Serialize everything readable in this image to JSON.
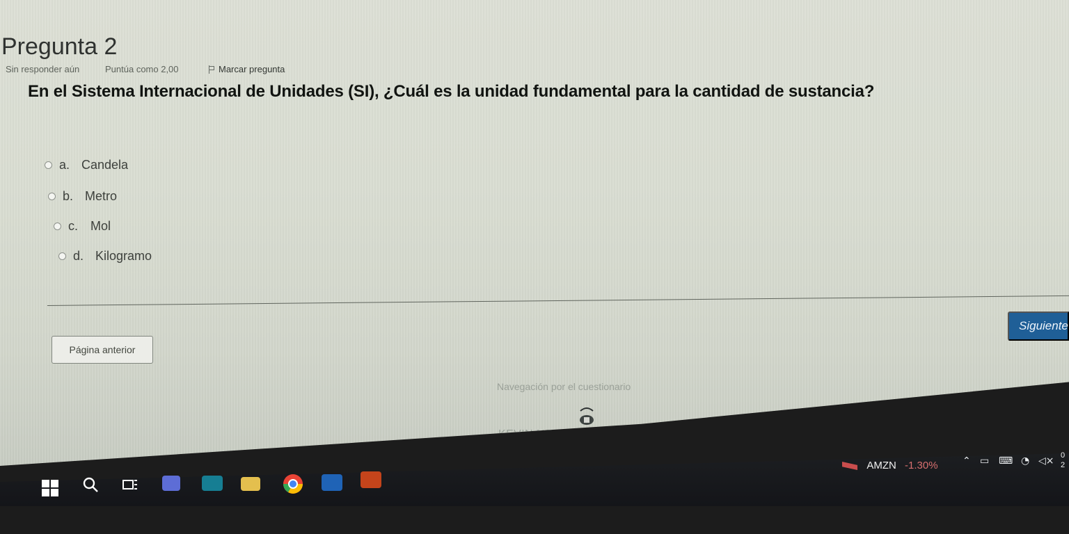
{
  "quiz": {
    "title": "Pregunta 2",
    "meta": {
      "status": "Sin responder aún",
      "score": "Puntúa como 2,00",
      "flag_label": "Marcar pregunta"
    },
    "question_text": "En el Sistema Internacional de Unidades (SI), ¿Cuál es la unidad fundamental para la cantidad de sustancia?",
    "options": [
      {
        "letter": "a.",
        "label": "Candela"
      },
      {
        "letter": "b.",
        "label": "Metro"
      },
      {
        "letter": "c.",
        "label": "Mol"
      },
      {
        "letter": "d.",
        "label": "Kilogramo"
      }
    ],
    "buttons": {
      "prev": "Página anterior",
      "next": "Siguiente"
    },
    "navigation": {
      "title": "Navegación por el cuestionario",
      "user_name": "KEVIN NEYK MUÑOZ BENDEZU"
    }
  },
  "taskbar": {
    "stock_label": "AMZN",
    "stock_change": "-1.30%",
    "clock_line1": "0",
    "clock_line2": "2"
  },
  "icons": {
    "flag": "flag-icon",
    "windows": "windows-icon",
    "search": "search-icon",
    "taskview": "task-view-icon",
    "teams": "teams-icon",
    "mail": "mail-icon",
    "folder": "folder-icon",
    "chrome": "chrome-icon",
    "word": "word-icon",
    "powerpoint": "powerpoint-icon",
    "stock": "stock-icon",
    "tray_up": "chevron-up-icon",
    "tray_1": "battery-icon",
    "tray_2": "keyboard-icon",
    "tray_3": "wifi-icon",
    "tray_4": "volume-icon"
  },
  "colors": {
    "next_button": "#1f5f97",
    "stock_negative": "#d76f6f"
  }
}
